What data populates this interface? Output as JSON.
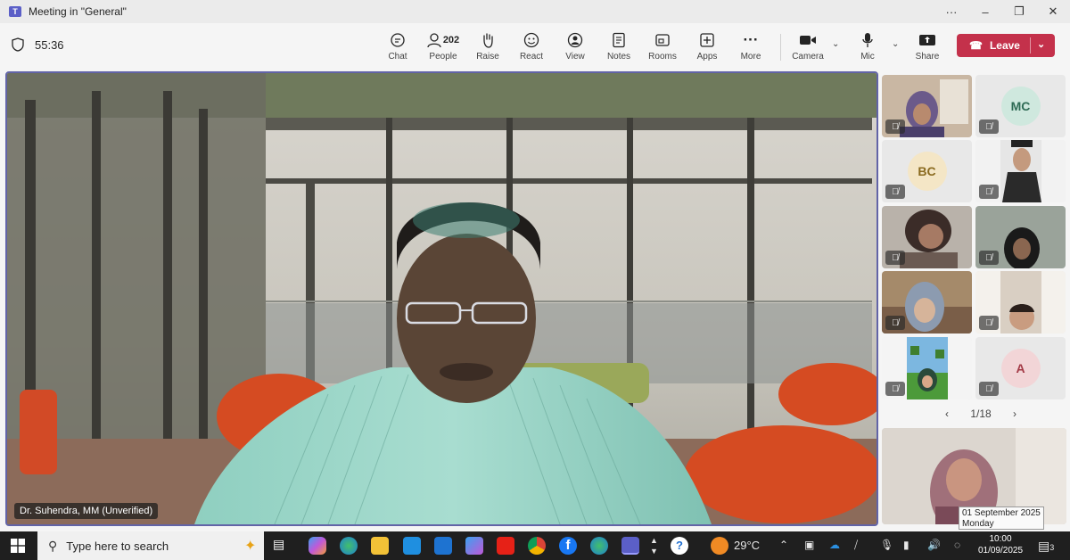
{
  "window": {
    "title": "Meeting in \"General\"",
    "controls": [
      "...",
      "–",
      "❐",
      "✕"
    ]
  },
  "toolbar": {
    "timer": "55:36",
    "chat": "Chat",
    "people": "People",
    "people_count": "202",
    "raise": "Raise",
    "react": "React",
    "view": "View",
    "notes": "Notes",
    "rooms": "Rooms",
    "apps": "Apps",
    "more": "More",
    "camera": "Camera",
    "mic": "Mic",
    "share": "Share",
    "leave": "Leave",
    "leave_color": "#c4314b"
  },
  "main_video": {
    "speaker_name": "Dr. Suhendra, MM (Unverified)",
    "highlight_color": "#6264a7"
  },
  "participants": {
    "tiles": [
      {
        "type": "video",
        "muted": true
      },
      {
        "type": "avatar",
        "initials": "MC",
        "avatar_bg": "#cfe8de",
        "avatar_fg": "#2f6b55",
        "muted": true
      },
      {
        "type": "avatar",
        "initials": "BC",
        "avatar_bg": "#f4e6c6",
        "avatar_fg": "#8a6a1f",
        "muted": true
      },
      {
        "type": "video",
        "muted": true
      },
      {
        "type": "video",
        "muted": true
      },
      {
        "type": "video",
        "muted": true
      },
      {
        "type": "video",
        "muted": true
      },
      {
        "type": "video",
        "muted": true
      },
      {
        "type": "video",
        "muted": true
      },
      {
        "type": "avatar",
        "initials": "A",
        "avatar_bg": "#f2d5d7",
        "avatar_fg": "#a33a46",
        "muted": true
      }
    ],
    "page_indicator": "1/18"
  },
  "tooltip": {
    "date": "01 September 2025",
    "day": "Monday"
  },
  "taskbar": {
    "search_placeholder": "Type here to search",
    "weather": "29°C",
    "time": "10:00",
    "date": "01/09/2025",
    "notification_count": "3"
  }
}
